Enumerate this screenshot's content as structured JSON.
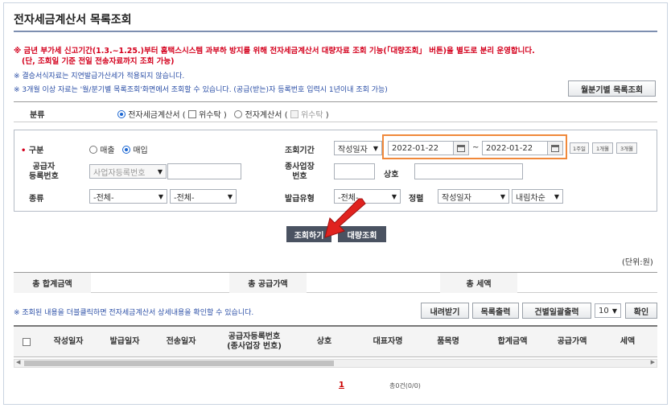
{
  "page": {
    "title": "전자세금계산서 목록조회",
    "notice_red_1": "※ 금년 부가세 신고기간(1.3.~1.25.)부터 홈택스시스템 과부하 방지를 위해 전자세금계산서 대량자료 조회 기능(「대량조회」 버튼)을 별도로 분리 운영합니다.",
    "notice_red_2": "(단, 조회일 기준 전일 전송자료까지 조회 가능)",
    "notice_blue_1": "※ 결승서식자료는 지연발급가산세가 적용되지 않습니다.",
    "notice_blue_2": "※ 3개월 이상 자료는 '월/분기별 목록조회'화면에서 조회할 수 있습니다. (공급(받는)자 등록번호 입력시 1년이내 조회 가능)",
    "monthly_button": "월분기별 목록조회"
  },
  "category": {
    "label": "분류",
    "opt_etax": "전자세금계산서",
    "paren_open": "(",
    "consign_label": "위수탁",
    "paren_close": ")",
    "opt_einvoice": "전자계산서",
    "selected": "전자세금계산서"
  },
  "search": {
    "required_mark": "•",
    "type_label": "구분",
    "type_sale": "매출",
    "type_buy": "매입",
    "type_selected": "매입",
    "period_label": "조회기간",
    "period_basis": "작성일자",
    "date_from": "2022-01-22",
    "date_sep": "~",
    "date_to": "2022-01-22",
    "quick_1w": "1주일",
    "quick_1m": "1개월",
    "quick_3m": "3개월",
    "supplier_label_1": "공급자",
    "supplier_label_2": "등록번호",
    "supplier_select": "사업자등록번호",
    "supplier_value": "",
    "branch_label_1": "종사업장",
    "branch_label_2": "번호",
    "branch_value": "",
    "company_label": "상호",
    "company_value": "",
    "kind_label": "종류",
    "kind_1": "-전체-",
    "kind_2": "-전체-",
    "issue_type_label": "발급유형",
    "issue_type": "-전체-",
    "sort_label": "정렬",
    "sort_field": "작성일자",
    "sort_order": "내림차순"
  },
  "actions": {
    "search_button": "조회하기",
    "bulk_button": "대량조회"
  },
  "summary": {
    "unit": "(단위:원)",
    "total_amount_label": "총 합계금액",
    "total_amount": "",
    "supply_amount_label": "총 공급가액",
    "supply_amount": "",
    "tax_label": "총 세액",
    "tax": ""
  },
  "result": {
    "hint": "※ 조회된 내용을 더블클릭하면 전자세금계산서 상세내용을 확인할 수 있습니다.",
    "download_button": "내려받기",
    "print_button": "목록출력",
    "batch_print_button": "건별일괄출력",
    "page_size": "10",
    "confirm_button": "확인"
  },
  "table": {
    "columns": [
      "작성일자",
      "발급일자",
      "전송일자",
      "공급자등록번호",
      "(종사업장 번호)",
      "상호",
      "대표자명",
      "품목명",
      "합계금액",
      "공급가액",
      "세액"
    ]
  },
  "pager": {
    "current": "1",
    "total": "총0건(0/0)"
  },
  "colors": {
    "required_red": "#d4001d",
    "notice_blue": "#2a4ea6",
    "highlight_orange": "#f0883a",
    "arrow_red": "#e0231f",
    "dark_button": "#4a5261"
  }
}
